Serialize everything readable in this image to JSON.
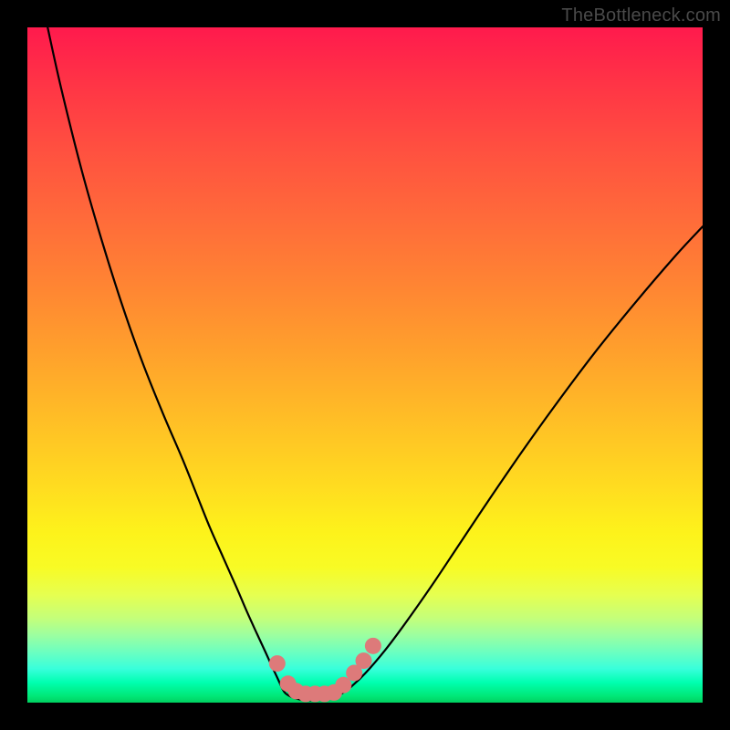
{
  "watermark": "TheBottleneck.com",
  "chart_data": {
    "type": "line",
    "title": "",
    "xlabel": "",
    "ylabel": "",
    "xlim": [
      0,
      100
    ],
    "ylim": [
      0,
      100
    ],
    "grid": false,
    "legend": false,
    "annotations": [],
    "series": [
      {
        "name": "left-curve",
        "color": "#000000",
        "x": [
          3,
          5,
          8,
          11,
          14,
          17,
          20,
          23,
          25,
          27,
          29,
          31,
          32.5,
          34,
          35.3,
          36.3,
          37.1,
          37.7,
          38.2
        ],
        "y": [
          100,
          91,
          79,
          68.5,
          59,
          50.5,
          43,
          36,
          31,
          26,
          21.5,
          17,
          13.5,
          10.2,
          7.4,
          5.2,
          3.5,
          2.2,
          1.4
        ]
      },
      {
        "name": "valley-floor",
        "color": "#000000",
        "x": [
          38.2,
          39,
          40,
          41,
          42,
          43,
          44,
          45,
          46,
          46.8
        ],
        "y": [
          1.4,
          0.9,
          0.55,
          0.4,
          0.35,
          0.4,
          0.55,
          0.8,
          1.1,
          1.5
        ]
      },
      {
        "name": "right-curve",
        "color": "#000000",
        "x": [
          46.8,
          48,
          50,
          53,
          56,
          60,
          64,
          68,
          73,
          78,
          84,
          90,
          96,
          100
        ],
        "y": [
          1.5,
          2.4,
          4.3,
          7.8,
          11.8,
          17.5,
          23.5,
          29.5,
          36.8,
          43.8,
          51.8,
          59.2,
          66.2,
          70.5
        ]
      }
    ],
    "markers": {
      "name": "l-shaped-dots",
      "color": "#dd7a7a",
      "radius_px": 9,
      "points": [
        {
          "x": 37.0,
          "y": 5.8
        },
        {
          "x": 38.6,
          "y": 2.8
        },
        {
          "x": 39.8,
          "y": 1.7
        },
        {
          "x": 41.2,
          "y": 1.3
        },
        {
          "x": 42.6,
          "y": 1.3
        },
        {
          "x": 44.0,
          "y": 1.3
        },
        {
          "x": 45.4,
          "y": 1.5
        },
        {
          "x": 46.8,
          "y": 2.6
        },
        {
          "x": 48.4,
          "y": 4.4
        },
        {
          "x": 49.8,
          "y": 6.2
        },
        {
          "x": 51.2,
          "y": 8.4
        }
      ]
    }
  }
}
